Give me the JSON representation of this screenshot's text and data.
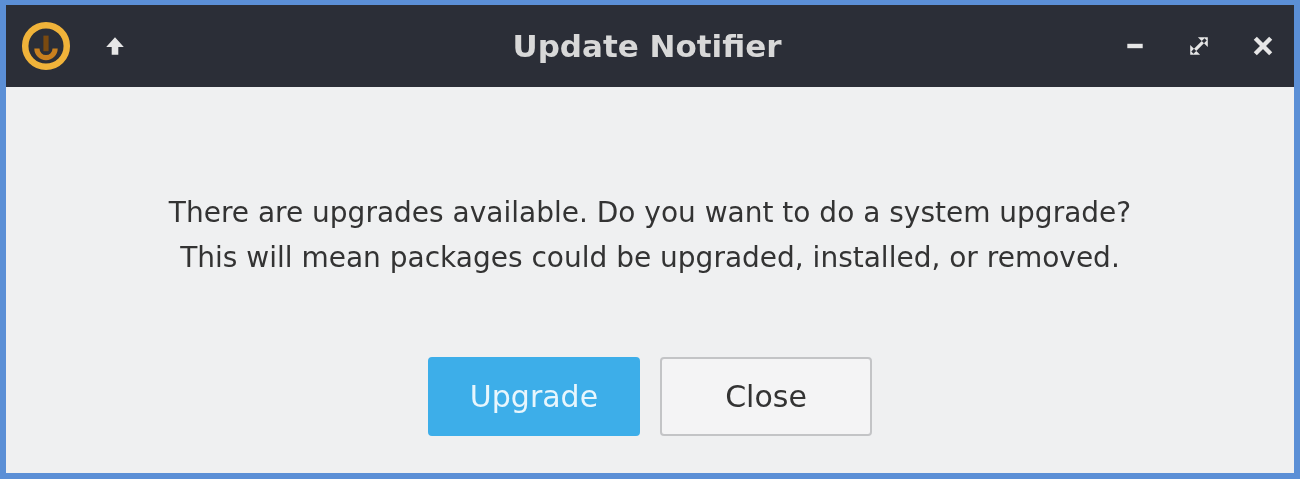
{
  "window": {
    "title": "Update Notifier"
  },
  "message": "There are upgrades available. Do you want to do a system upgrade?\nThis will mean packages could be upgraded, installed, or removed.",
  "buttons": [
    {
      "label": "Upgrade",
      "default": true
    },
    {
      "label": "Close",
      "default": false
    }
  ]
}
